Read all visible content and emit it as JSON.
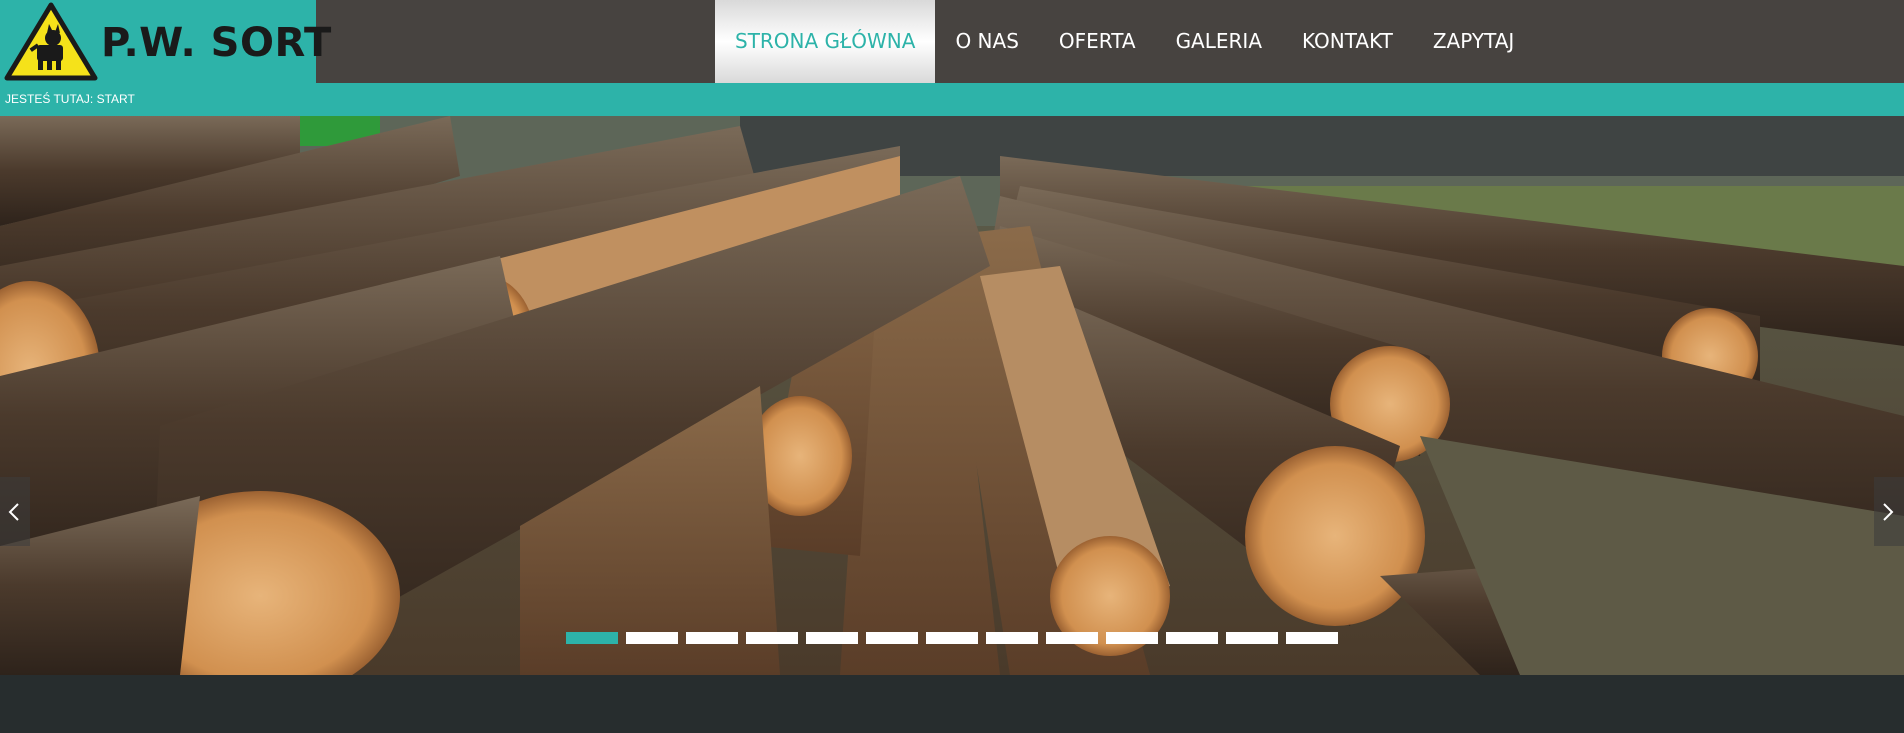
{
  "brand": {
    "name": "P.W. SORT",
    "logo_icon": "dog-warning-sign-icon",
    "color": "#2db3a9"
  },
  "nav": {
    "items": [
      {
        "label": "STRONA GŁÓWNA",
        "active": true
      },
      {
        "label": "O NAS"
      },
      {
        "label": "OFERTA"
      },
      {
        "label": "GALERIA"
      },
      {
        "label": "KONTAKT"
      },
      {
        "label": "ZAPYTAJ"
      }
    ]
  },
  "breadcrumb": {
    "text": "JESTEŚ TUTAJ: START"
  },
  "slider": {
    "image_subject": "stacked timber logs",
    "prev_icon": "chevron-left-icon",
    "next_icon": "chevron-right-icon",
    "slide_count": 13,
    "active_slide": 1
  },
  "colors": {
    "header_bg": "#474340",
    "accent": "#2db3a9",
    "footer_bg": "#272d2e"
  }
}
